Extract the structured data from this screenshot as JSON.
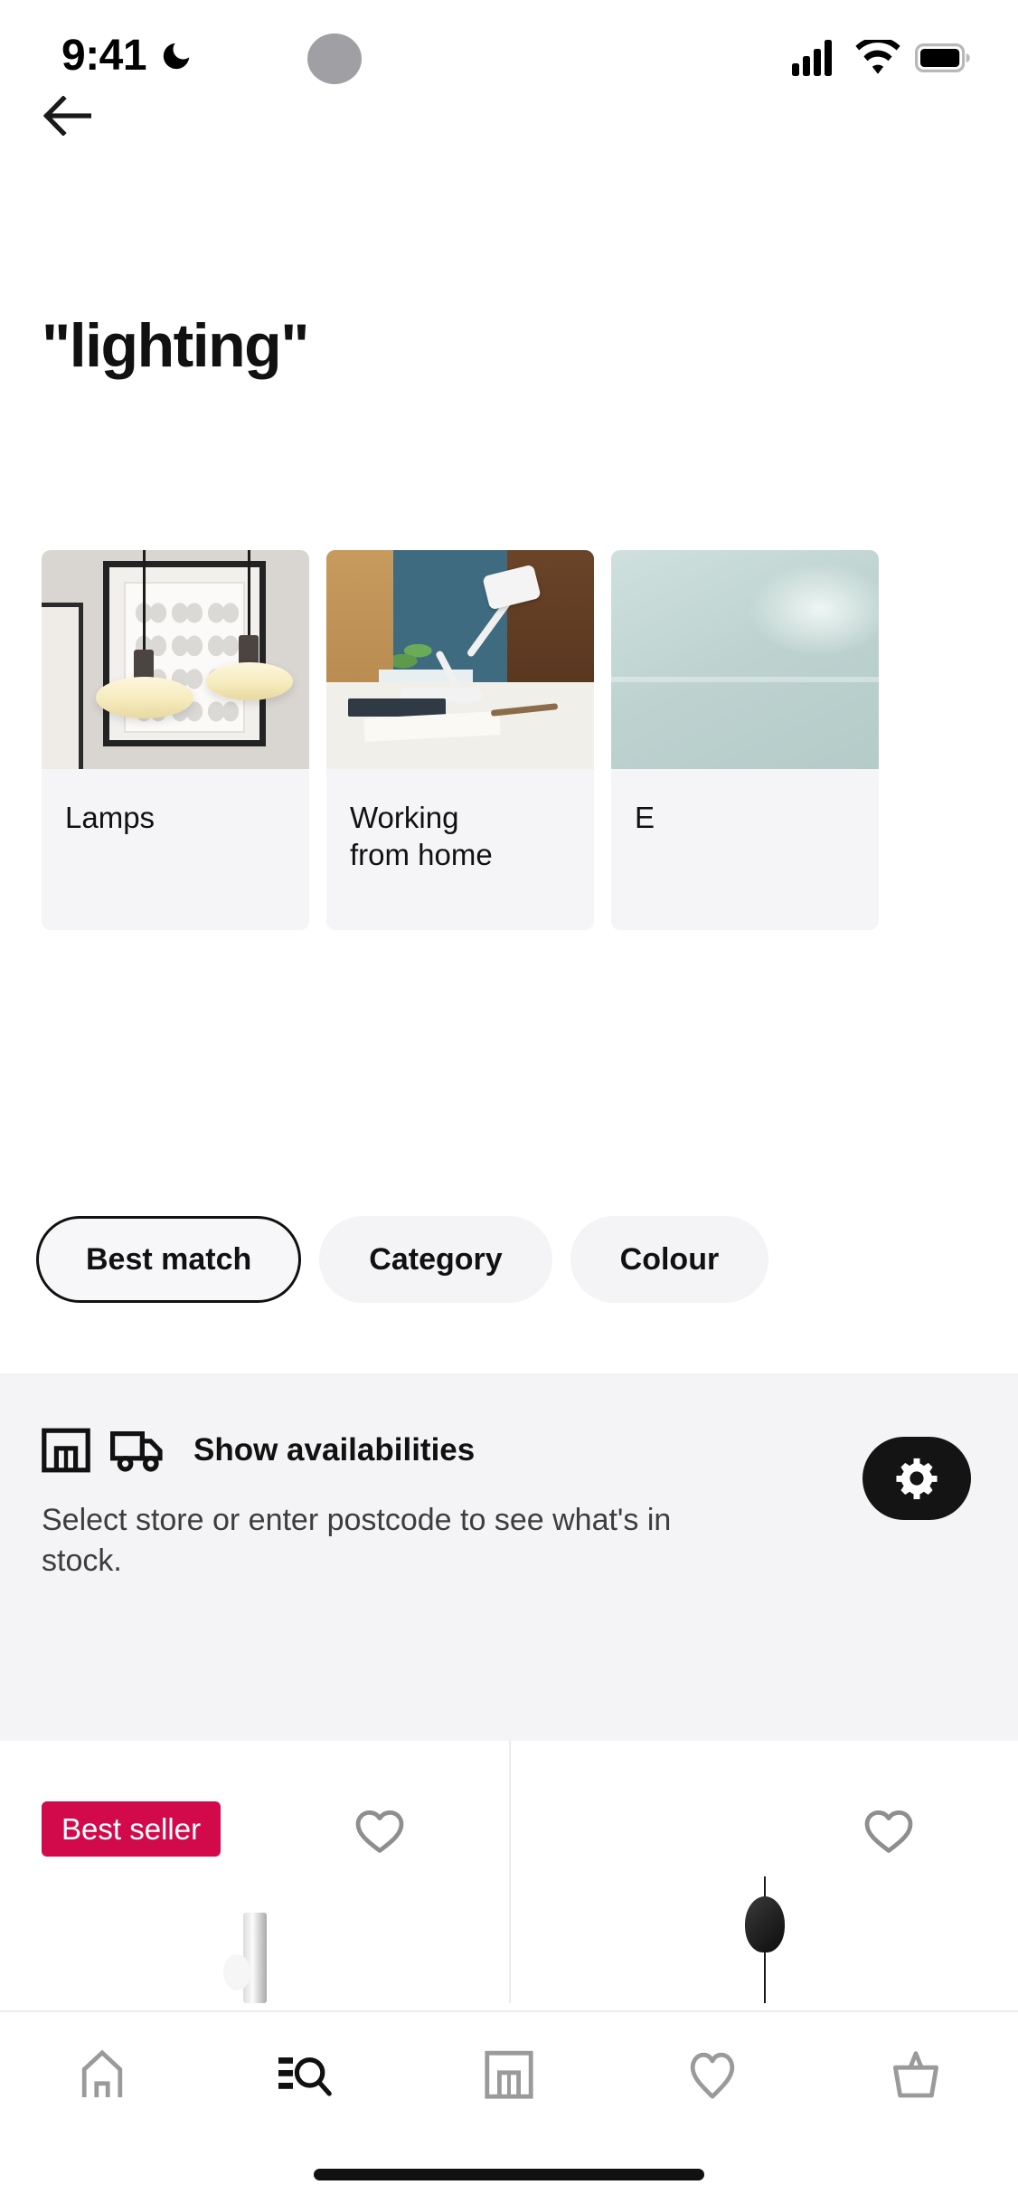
{
  "status_bar": {
    "time": "9:41",
    "dnd_icon": "moon-icon",
    "signal_icon": "cellular-signal-icon",
    "wifi_icon": "wifi-icon",
    "battery_icon": "battery-full-icon",
    "camera_cutout": "camera-dot"
  },
  "header": {
    "back_icon": "arrow-left-icon",
    "title": "\"lighting\""
  },
  "category_cards": [
    {
      "label": "Lamps",
      "art": "pendant-lamps-photo"
    },
    {
      "label": "Working\nfrom home",
      "label_line1": "Working",
      "label_line2": "from home",
      "art": "desk-lamp-photo"
    },
    {
      "label": "E",
      "art": "mint-room-photo"
    }
  ],
  "filter_chips": [
    {
      "label": "Best match",
      "active": true
    },
    {
      "label": "Category",
      "active": false
    },
    {
      "label": "Colour",
      "active": false
    }
  ],
  "availability": {
    "store_icon": "store-icon",
    "truck_icon": "delivery-truck-icon",
    "title": "Show availabilities",
    "description": "Select store or enter postcode to see what's in stock.",
    "settings_icon": "gear-icon",
    "background_color": "#f4f4f6",
    "button_color": "#141414"
  },
  "products": [
    {
      "badge": "Best seller",
      "badge_color": "#d20a4c",
      "favourite_icon": "heart-outline-icon",
      "art": "wall-lamp-photo"
    },
    {
      "badge": "",
      "favourite_icon": "heart-outline-icon",
      "art": "pendant-lamp-photo"
    }
  ],
  "bottom_nav": [
    {
      "icon": "home-icon",
      "label": "Home",
      "active": false
    },
    {
      "icon": "search-list-icon",
      "label": "Search",
      "active": true
    },
    {
      "icon": "store-icon",
      "label": "Stores",
      "active": false
    },
    {
      "icon": "heart-outline-icon",
      "label": "Favourites",
      "active": false
    },
    {
      "icon": "basket-icon",
      "label": "Basket",
      "active": false
    }
  ],
  "home_indicator": "home-indicator-bar"
}
